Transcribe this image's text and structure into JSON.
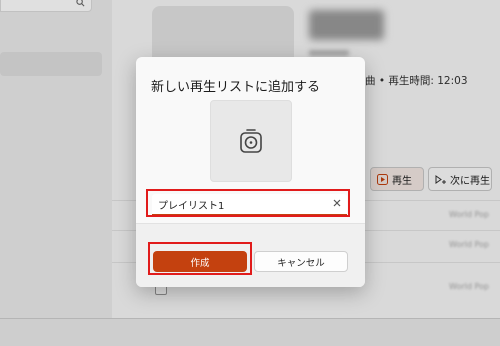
{
  "album": {
    "meta_text": "曲 • 再生時間: 12:03",
    "play_label": "再生",
    "next_label": "次に再生",
    "row_label": "World Pop"
  },
  "dialog": {
    "title": "新しい再生リストに追加する",
    "input_value": "プレイリスト1",
    "create_label": "作成",
    "cancel_label": "キャンセル"
  },
  "colors": {
    "accent": "#c4410f",
    "highlight": "#e11b1b"
  },
  "icons": [
    "search-icon",
    "playlist-thumbnail-icon",
    "clear-icon",
    "play-icon",
    "play-next-icon"
  ]
}
